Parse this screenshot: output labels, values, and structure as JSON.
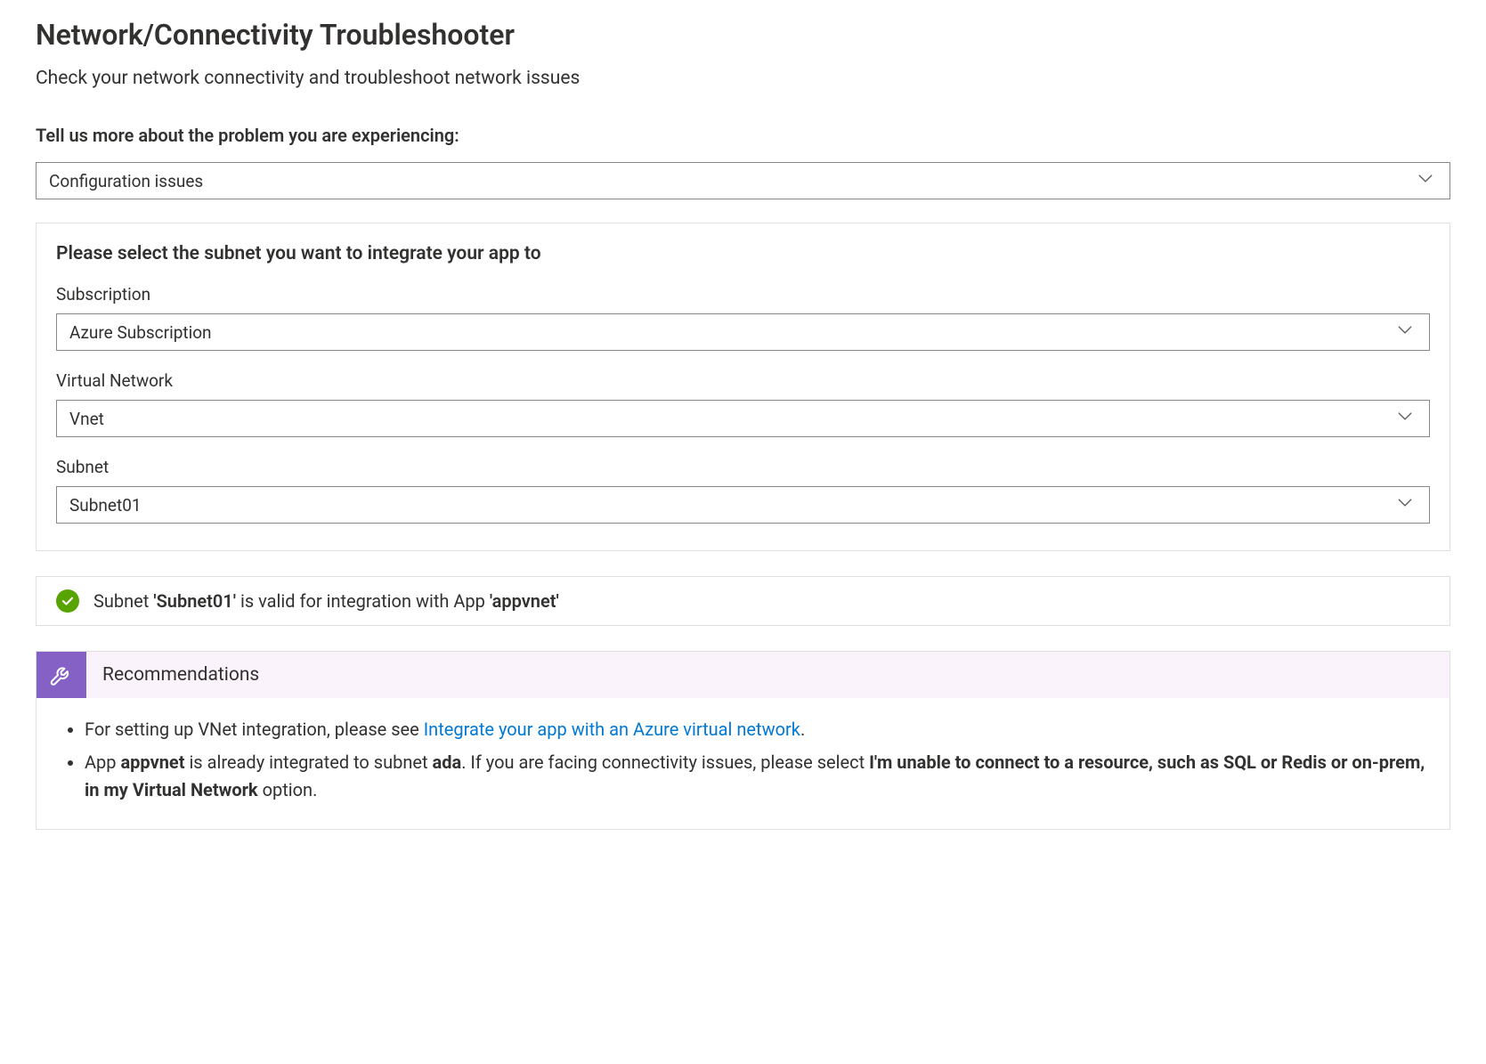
{
  "header": {
    "title": "Network/Connectivity Troubleshooter",
    "subtitle": "Check your network connectivity and troubleshoot network issues"
  },
  "problem": {
    "label": "Tell us more about the problem you are experiencing:",
    "value": "Configuration issues"
  },
  "subnetPanel": {
    "title": "Please select the subnet you want to integrate your app to",
    "subscription": {
      "label": "Subscription",
      "value": "Azure Subscription"
    },
    "vnet": {
      "label": "Virtual Network",
      "value": "Vnet"
    },
    "subnet": {
      "label": "Subnet",
      "value": "Subnet01"
    }
  },
  "status": {
    "prefix": "Subnet ",
    "subnetNameQuoted": "'Subnet01' ",
    "mid": "is valid for integration with App ",
    "appNameQuoted": "'appvnet'"
  },
  "reco": {
    "title": "Recommendations",
    "item1": {
      "before": "For setting up VNet integration, please see ",
      "linkText": "Integrate your app with an Azure virtual network",
      "after": "."
    },
    "item2": {
      "t1": "App ",
      "appName": "appvnet",
      "t2": " is already integrated to subnet ",
      "subnetName": "ada",
      "t3": ". If you are facing connectivity issues, please select ",
      "boldOption": "I'm unable to connect to a resource, such as SQL or Redis or on-prem, in my Virtual Network",
      "t4": " option."
    }
  }
}
